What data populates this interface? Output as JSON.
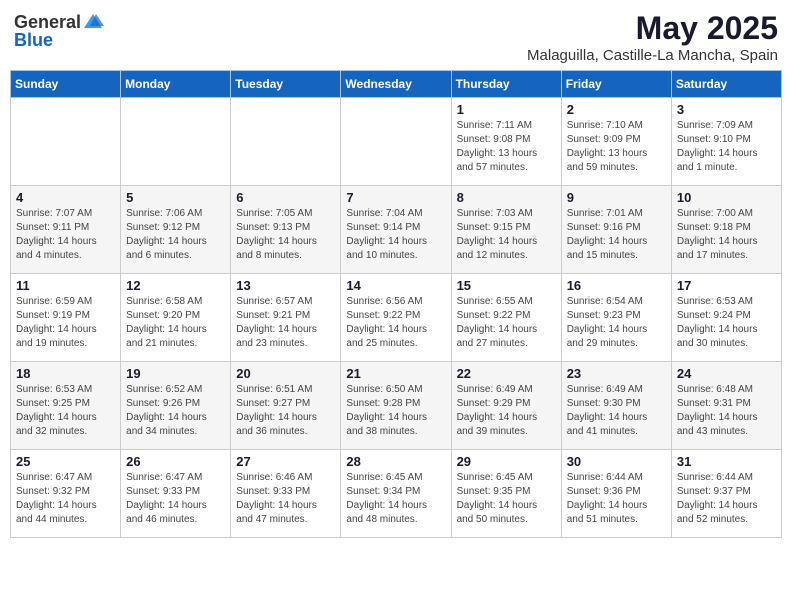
{
  "header": {
    "logo_general": "General",
    "logo_blue": "Blue",
    "month": "May 2025",
    "location": "Malaguilla, Castille-La Mancha, Spain"
  },
  "days_of_week": [
    "Sunday",
    "Monday",
    "Tuesday",
    "Wednesday",
    "Thursday",
    "Friday",
    "Saturday"
  ],
  "weeks": [
    [
      {
        "day": "",
        "detail": ""
      },
      {
        "day": "",
        "detail": ""
      },
      {
        "day": "",
        "detail": ""
      },
      {
        "day": "",
        "detail": ""
      },
      {
        "day": "1",
        "detail": "Sunrise: 7:11 AM\nSunset: 9:08 PM\nDaylight: 13 hours\nand 57 minutes."
      },
      {
        "day": "2",
        "detail": "Sunrise: 7:10 AM\nSunset: 9:09 PM\nDaylight: 13 hours\nand 59 minutes."
      },
      {
        "day": "3",
        "detail": "Sunrise: 7:09 AM\nSunset: 9:10 PM\nDaylight: 14 hours\nand 1 minute."
      }
    ],
    [
      {
        "day": "4",
        "detail": "Sunrise: 7:07 AM\nSunset: 9:11 PM\nDaylight: 14 hours\nand 4 minutes."
      },
      {
        "day": "5",
        "detail": "Sunrise: 7:06 AM\nSunset: 9:12 PM\nDaylight: 14 hours\nand 6 minutes."
      },
      {
        "day": "6",
        "detail": "Sunrise: 7:05 AM\nSunset: 9:13 PM\nDaylight: 14 hours\nand 8 minutes."
      },
      {
        "day": "7",
        "detail": "Sunrise: 7:04 AM\nSunset: 9:14 PM\nDaylight: 14 hours\nand 10 minutes."
      },
      {
        "day": "8",
        "detail": "Sunrise: 7:03 AM\nSunset: 9:15 PM\nDaylight: 14 hours\nand 12 minutes."
      },
      {
        "day": "9",
        "detail": "Sunrise: 7:01 AM\nSunset: 9:16 PM\nDaylight: 14 hours\nand 15 minutes."
      },
      {
        "day": "10",
        "detail": "Sunrise: 7:00 AM\nSunset: 9:18 PM\nDaylight: 14 hours\nand 17 minutes."
      }
    ],
    [
      {
        "day": "11",
        "detail": "Sunrise: 6:59 AM\nSunset: 9:19 PM\nDaylight: 14 hours\nand 19 minutes."
      },
      {
        "day": "12",
        "detail": "Sunrise: 6:58 AM\nSunset: 9:20 PM\nDaylight: 14 hours\nand 21 minutes."
      },
      {
        "day": "13",
        "detail": "Sunrise: 6:57 AM\nSunset: 9:21 PM\nDaylight: 14 hours\nand 23 minutes."
      },
      {
        "day": "14",
        "detail": "Sunrise: 6:56 AM\nSunset: 9:22 PM\nDaylight: 14 hours\nand 25 minutes."
      },
      {
        "day": "15",
        "detail": "Sunrise: 6:55 AM\nSunset: 9:22 PM\nDaylight: 14 hours\nand 27 minutes."
      },
      {
        "day": "16",
        "detail": "Sunrise: 6:54 AM\nSunset: 9:23 PM\nDaylight: 14 hours\nand 29 minutes."
      },
      {
        "day": "17",
        "detail": "Sunrise: 6:53 AM\nSunset: 9:24 PM\nDaylight: 14 hours\nand 30 minutes."
      }
    ],
    [
      {
        "day": "18",
        "detail": "Sunrise: 6:53 AM\nSunset: 9:25 PM\nDaylight: 14 hours\nand 32 minutes."
      },
      {
        "day": "19",
        "detail": "Sunrise: 6:52 AM\nSunset: 9:26 PM\nDaylight: 14 hours\nand 34 minutes."
      },
      {
        "day": "20",
        "detail": "Sunrise: 6:51 AM\nSunset: 9:27 PM\nDaylight: 14 hours\nand 36 minutes."
      },
      {
        "day": "21",
        "detail": "Sunrise: 6:50 AM\nSunset: 9:28 PM\nDaylight: 14 hours\nand 38 minutes."
      },
      {
        "day": "22",
        "detail": "Sunrise: 6:49 AM\nSunset: 9:29 PM\nDaylight: 14 hours\nand 39 minutes."
      },
      {
        "day": "23",
        "detail": "Sunrise: 6:49 AM\nSunset: 9:30 PM\nDaylight: 14 hours\nand 41 minutes."
      },
      {
        "day": "24",
        "detail": "Sunrise: 6:48 AM\nSunset: 9:31 PM\nDaylight: 14 hours\nand 43 minutes."
      }
    ],
    [
      {
        "day": "25",
        "detail": "Sunrise: 6:47 AM\nSunset: 9:32 PM\nDaylight: 14 hours\nand 44 minutes."
      },
      {
        "day": "26",
        "detail": "Sunrise: 6:47 AM\nSunset: 9:33 PM\nDaylight: 14 hours\nand 46 minutes."
      },
      {
        "day": "27",
        "detail": "Sunrise: 6:46 AM\nSunset: 9:33 PM\nDaylight: 14 hours\nand 47 minutes."
      },
      {
        "day": "28",
        "detail": "Sunrise: 6:45 AM\nSunset: 9:34 PM\nDaylight: 14 hours\nand 48 minutes."
      },
      {
        "day": "29",
        "detail": "Sunrise: 6:45 AM\nSunset: 9:35 PM\nDaylight: 14 hours\nand 50 minutes."
      },
      {
        "day": "30",
        "detail": "Sunrise: 6:44 AM\nSunset: 9:36 PM\nDaylight: 14 hours\nand 51 minutes."
      },
      {
        "day": "31",
        "detail": "Sunrise: 6:44 AM\nSunset: 9:37 PM\nDaylight: 14 hours\nand 52 minutes."
      }
    ]
  ]
}
